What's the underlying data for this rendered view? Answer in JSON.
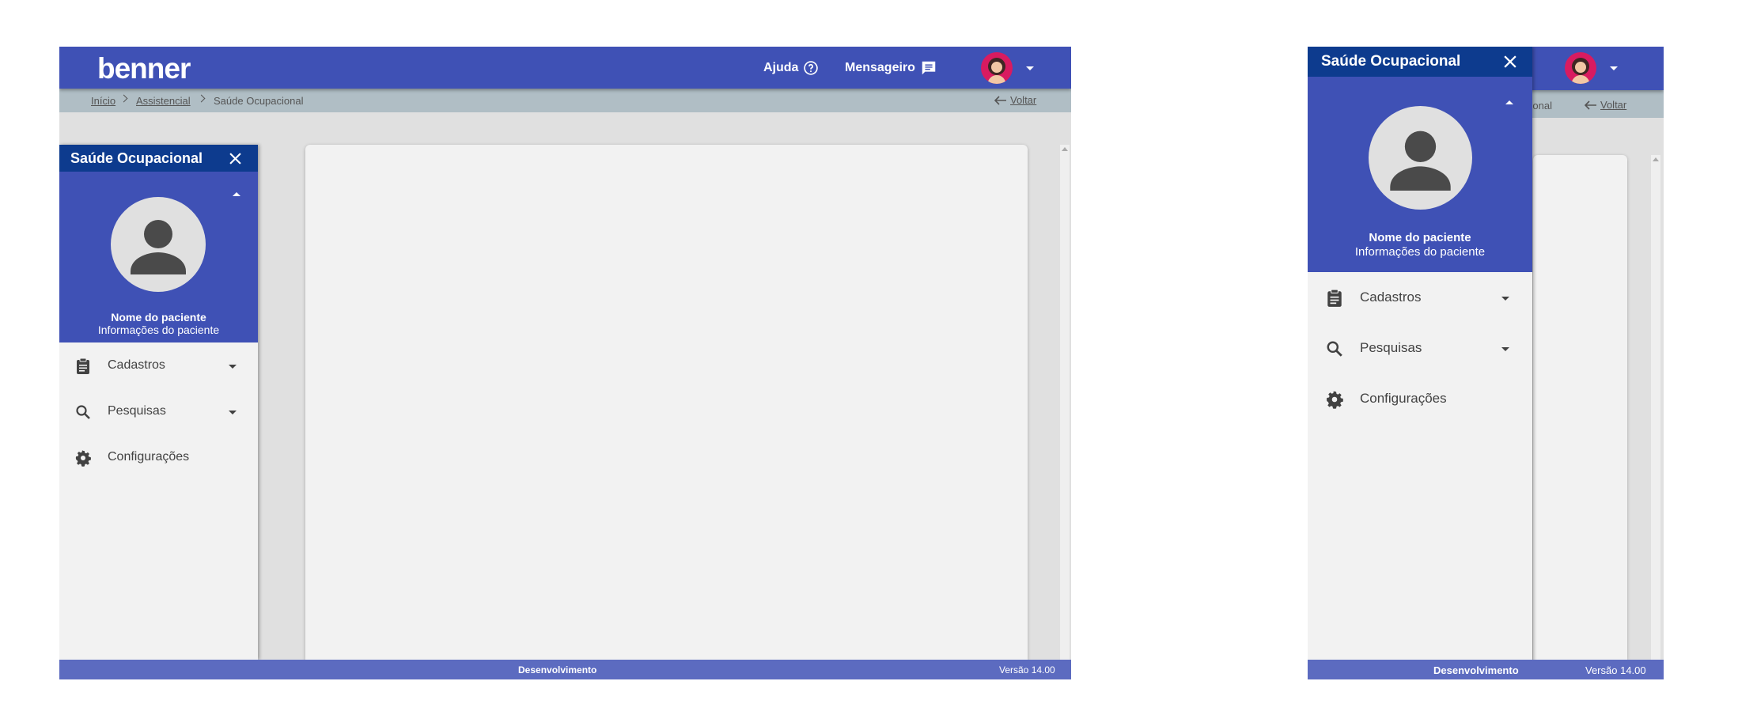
{
  "header": {
    "logo": "benner",
    "help_label": "Ajuda",
    "messenger_label": "Mensageiro"
  },
  "breadcrumb": {
    "items": [
      "Início",
      "Assistencial",
      "Saúde Ocupacional"
    ],
    "mobile_partial": "cional",
    "back_label": "Voltar"
  },
  "drawer": {
    "title": "Saúde Ocupacional",
    "patient_name": "Nome do paciente",
    "patient_info": "Informações do paciente",
    "menu": [
      {
        "label": "Cadastros",
        "icon": "clipboard-icon",
        "expandable": true
      },
      {
        "label": "Pesquisas",
        "icon": "search-icon",
        "expandable": true
      },
      {
        "label": "Configurações",
        "icon": "gear-icon",
        "expandable": false
      }
    ]
  },
  "footer": {
    "environment": "Desenvolvimento",
    "version": "Versão 14.00"
  },
  "colors": {
    "primary": "#3f51b5",
    "drawer_header": "#0d3b8e",
    "footer": "#5c6bc0",
    "breadcrumb_bar": "#b0bec5"
  }
}
